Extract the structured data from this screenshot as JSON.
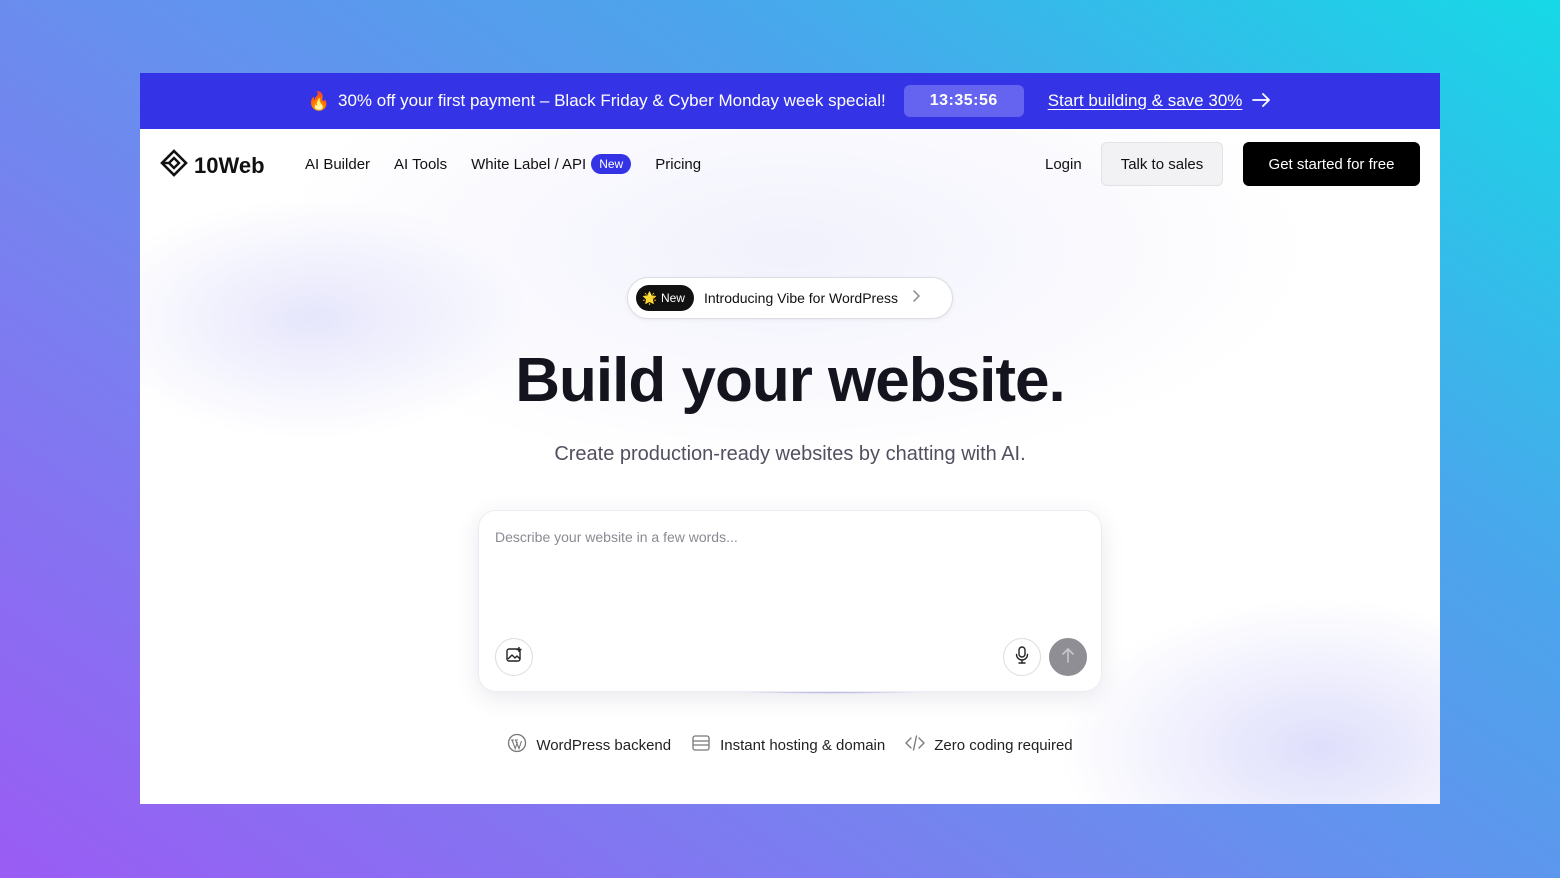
{
  "promo": {
    "icon": "fire-icon",
    "text": "30% off your first payment – Black Friday & Cyber Monday week special!",
    "timer": "13:35:56",
    "cta": "Start building & save 30%",
    "background": "#3434e6"
  },
  "nav": {
    "logo": "10Web",
    "links": [
      {
        "label": "AI Builder"
      },
      {
        "label": "AI Tools"
      },
      {
        "label": "White Label / API",
        "badge": "New"
      },
      {
        "label": "Pricing"
      }
    ],
    "login": "Login",
    "talk_to_sales": "Talk to sales",
    "get_started": "Get started for free"
  },
  "hero": {
    "pill_badge": "New",
    "pill_text": "Introducing Vibe for WordPress",
    "headline": "Build your website.",
    "subhead": "Create production-ready websites by chatting with AI."
  },
  "prompt": {
    "placeholder": "Describe your website in a few words...",
    "value": ""
  },
  "features": [
    {
      "icon": "wordpress-icon",
      "label": "WordPress backend"
    },
    {
      "icon": "server-icon",
      "label": "Instant hosting & domain"
    },
    {
      "icon": "code-icon",
      "label": "Zero coding required"
    }
  ]
}
